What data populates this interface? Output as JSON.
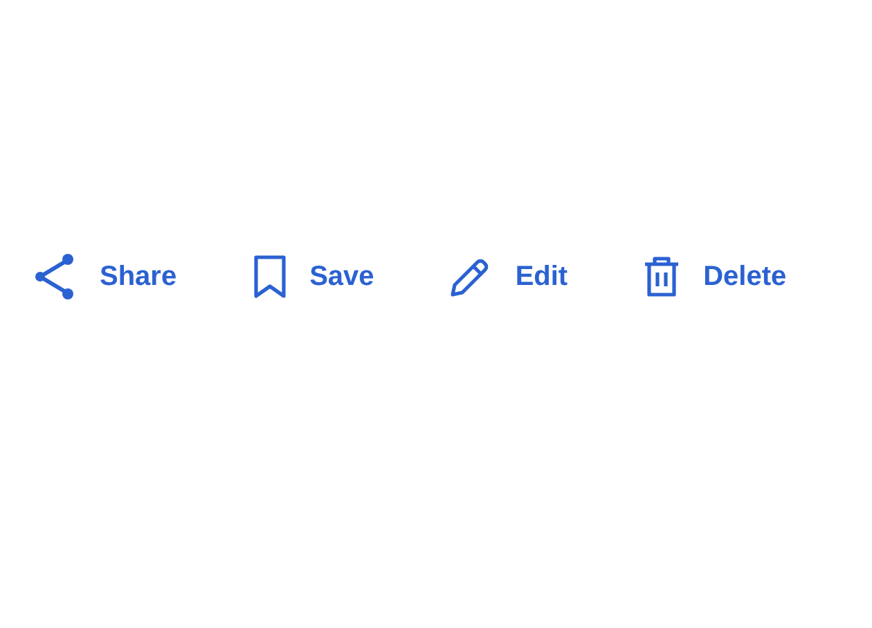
{
  "actions": [
    {
      "kind": "share",
      "label": "Share"
    },
    {
      "kind": "save",
      "label": "Save"
    },
    {
      "kind": "edit",
      "label": "Edit"
    },
    {
      "kind": "delete",
      "label": "Delete"
    }
  ]
}
